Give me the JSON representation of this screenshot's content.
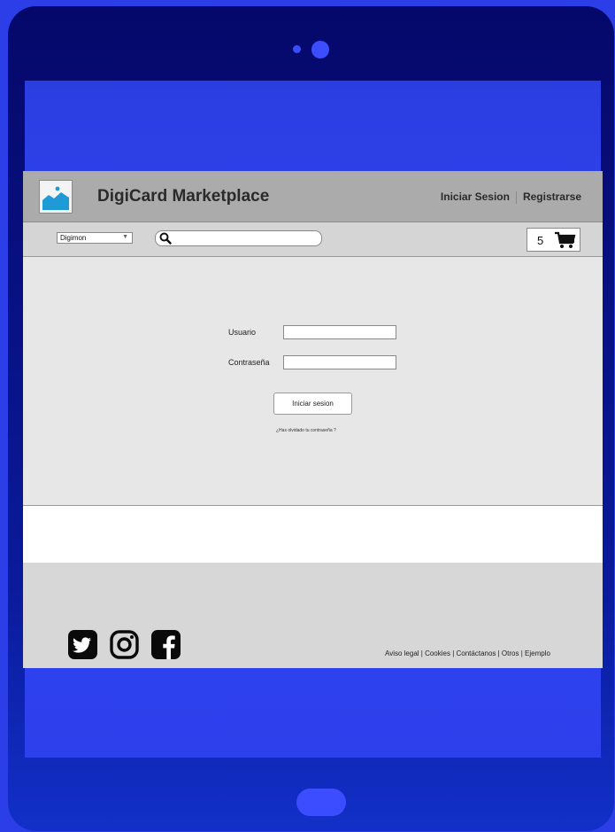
{
  "app": {
    "title": "DigiCard Marketplace",
    "login_link": "Iniciar Sesion",
    "register_link": "Registrarse"
  },
  "toolbar": {
    "category_selected": "Digimon",
    "search_placeholder": "",
    "cart_count": "5"
  },
  "login_form": {
    "username_label": "Usuario",
    "username_value": "",
    "password_label": "Contraseña",
    "password_value": "",
    "submit_label": "Iniciar sesion",
    "forgot_link": "¿Has olvidado tu contraseña ?"
  },
  "footer": {
    "social_icons": [
      "twitter-icon",
      "instagram-icon",
      "facebook-icon"
    ],
    "links_text": "Aviso legal | Cookies | Contáctanos | Otros | Ejemplo"
  },
  "colors": {
    "page_bg": "#2b3ee8",
    "tablet_frame": "#05086a",
    "header_bg": "#ababab",
    "toolbar_bg": "#d5d5d5",
    "content_bg": "#e7e7e7",
    "footer_bg": "#d7d7d7",
    "button_accent": "#3b4dff"
  }
}
